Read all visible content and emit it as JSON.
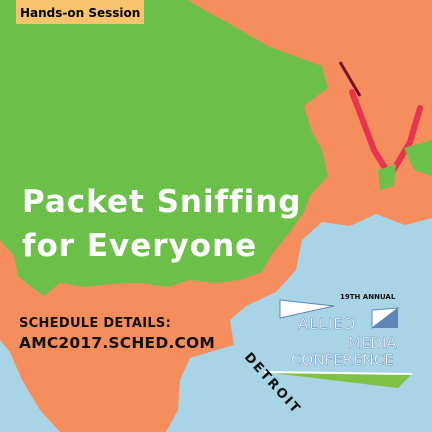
{
  "badge": {
    "label": "Hands-on Session"
  },
  "headline": {
    "line1": "Packet Sniffing",
    "line2": "for Everyone"
  },
  "schedule": {
    "label": "SCHEDULE DETAILS:",
    "url": "AMC2017.SCHED.COM"
  },
  "conference": {
    "annual": "19TH ANNUAL",
    "line1": "ALLIED",
    "line2": "MEDIA",
    "line3": "CONFERENCE",
    "city": "DETROIT"
  },
  "colors": {
    "sky": "#a9d4e6",
    "green": "#6cc04a",
    "orange": "#f58d5c",
    "badge": "#f7c46b",
    "logo_blue": "#5c87b8",
    "logo_green": "#7dc242",
    "accent_red": "#e8344e"
  }
}
